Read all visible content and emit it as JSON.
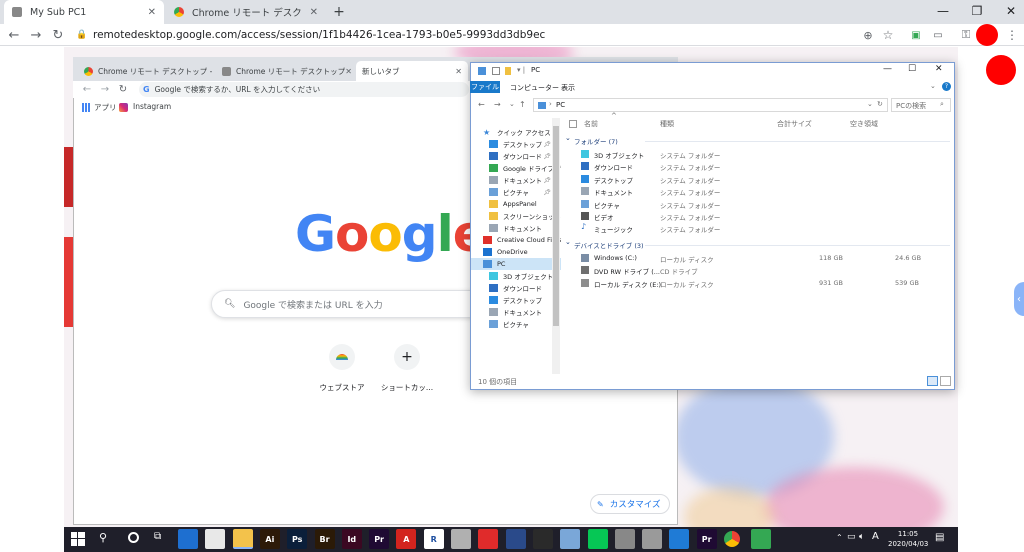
{
  "browser": {
    "tabs": [
      {
        "title": "My Sub PC1",
        "active": true
      },
      {
        "title": "Chrome リモート デスクトップ - Chrom",
        "active": false
      }
    ],
    "new_tab_symbol": "+",
    "url": "remotedesktop.google.com/access/session/1f1b4426-1cea-1793-b0e5-9993dd3db9ec"
  },
  "remote": {
    "inner_chrome": {
      "tabs": [
        {
          "title": "Chrome リモート デスクトップ - Chrom"
        },
        {
          "title": "Chrome リモート デスクトップ"
        },
        {
          "title": "新しいタブ"
        }
      ],
      "address_placeholder": "Google で検索するか、URL を入力してください",
      "bookmarks": [
        "アプリ",
        "Instagram"
      ],
      "google_logo": [
        "G",
        "o",
        "o",
        "g",
        "l",
        "e"
      ],
      "logo_colors": [
        "#4285F4",
        "#EA4335",
        "#FBBC05",
        "#4285F4",
        "#34A853",
        "#EA4335"
      ],
      "search_placeholder": "Google で検索または URL を入力",
      "shortcuts": [
        {
          "label": "ウェブストア",
          "icon": "rainbow-icon"
        },
        {
          "label": "ショートカッ...",
          "icon": "plus-icon",
          "symbol": "+"
        }
      ],
      "customize_label": "カスタマイズ"
    },
    "explorer": {
      "title": "PC",
      "ribbon_tabs": [
        "ファイル",
        "コンピューター",
        "表示"
      ],
      "breadcrumb": "PC",
      "search_placeholder": "PCの検索",
      "nav_items": [
        {
          "label": "クイック アクセス",
          "icon": "star-icon",
          "level": 0
        },
        {
          "label": "デスクトップ",
          "icon": "desktop-icon",
          "level": 1,
          "pinned": true
        },
        {
          "label": "ダウンロード",
          "icon": "download-icon",
          "level": 1,
          "pinned": true
        },
        {
          "label": "Google ドライブ",
          "icon": "drive-icon",
          "level": 1,
          "pinned": true
        },
        {
          "label": "ドキュメント",
          "icon": "document-icon",
          "level": 1,
          "pinned": true
        },
        {
          "label": "ピクチャ",
          "icon": "picture-icon",
          "level": 1,
          "pinned": true
        },
        {
          "label": "AppsPanel",
          "icon": "folder-icon",
          "level": 1
        },
        {
          "label": "スクリーンショット",
          "icon": "folder-icon",
          "level": 1
        },
        {
          "label": "ドキュメント",
          "icon": "document-icon",
          "level": 1
        },
        {
          "label": "Creative Cloud Files",
          "icon": "creative-cloud-icon",
          "level": 0
        },
        {
          "label": "OneDrive",
          "icon": "onedrive-icon",
          "level": 0
        },
        {
          "label": "PC",
          "icon": "pc-icon",
          "level": 0,
          "selected": true
        },
        {
          "label": "3D オブジェクト",
          "icon": "3d-icon",
          "level": 1
        },
        {
          "label": "ダウンロード",
          "icon": "download-icon",
          "level": 1
        },
        {
          "label": "デスクトップ",
          "icon": "desktop-icon",
          "level": 1
        },
        {
          "label": "ドキュメント",
          "icon": "document-icon",
          "level": 1
        },
        {
          "label": "ピクチャ",
          "icon": "picture-icon",
          "level": 1
        }
      ],
      "columns": [
        "名前",
        "種類",
        "合計サイズ",
        "空き領域"
      ],
      "groups": [
        {
          "header": "フォルダー (7)",
          "rows": [
            {
              "name": "3D オブジェクト",
              "type": "システム フォルダー",
              "total": "",
              "free": "",
              "icon": "3d-icon"
            },
            {
              "name": "ダウンロード",
              "type": "システム フォルダー",
              "total": "",
              "free": "",
              "icon": "download-icon"
            },
            {
              "name": "デスクトップ",
              "type": "システム フォルダー",
              "total": "",
              "free": "",
              "icon": "desktop-icon"
            },
            {
              "name": "ドキュメント",
              "type": "システム フォルダー",
              "total": "",
              "free": "",
              "icon": "document-icon"
            },
            {
              "name": "ピクチャ",
              "type": "システム フォルダー",
              "total": "",
              "free": "",
              "icon": "picture-icon"
            },
            {
              "name": "ビデオ",
              "type": "システム フォルダー",
              "total": "",
              "free": "",
              "icon": "video-icon"
            },
            {
              "name": "ミュージック",
              "type": "システム フォルダー",
              "total": "",
              "free": "",
              "icon": "music-icon"
            }
          ]
        },
        {
          "header": "デバイスとドライブ (3)",
          "rows": [
            {
              "name": "Windows (C:)",
              "type": "ローカル ディスク",
              "total": "118 GB",
              "free": "24.6 GB",
              "icon": "drive-c-icon"
            },
            {
              "name": "DVD RW ドライブ (...",
              "type": "CD ドライブ",
              "total": "",
              "free": "",
              "icon": "dvd-icon"
            },
            {
              "name": "ローカル ディスク (E:)",
              "type": "ローカル ディスク",
              "total": "931 GB",
              "free": "539 GB",
              "icon": "disk-icon"
            }
          ]
        }
      ],
      "status": "10 個の項目"
    },
    "taskbar": {
      "apps": [
        {
          "label": "",
          "icon": "edge-icon",
          "color": "#1e6fd0"
        },
        {
          "label": "",
          "icon": "pdf-icon",
          "color": "#e8e8e8"
        },
        {
          "label": "",
          "icon": "file-explorer-icon",
          "color": "#f3c24b"
        },
        {
          "label": "Ai",
          "icon": "illustrator-icon",
          "color": "#2d1a08"
        },
        {
          "label": "Ps",
          "icon": "photoshop-icon",
          "color": "#0b1f3a"
        },
        {
          "label": "Br",
          "icon": "bridge-icon",
          "color": "#2b1a07"
        },
        {
          "label": "Id",
          "icon": "indesign-icon",
          "color": "#3b0822"
        },
        {
          "label": "Pr",
          "icon": "premiere-icon",
          "color": "#1f0a33"
        },
        {
          "label": "A",
          "icon": "acrobat-icon",
          "color": "#d3241e"
        },
        {
          "label": "R",
          "icon": "r-icon",
          "color": "#ffffff"
        },
        {
          "label": "",
          "icon": "pdf-tool-icon",
          "color": "#b0b0b0"
        },
        {
          "label": "",
          "icon": "camera-app-icon",
          "color": "#e02b2b"
        },
        {
          "label": "",
          "icon": "circle-app-icon",
          "color": "#2a4a8a"
        },
        {
          "label": "",
          "icon": "unreal-icon",
          "color": "#2a2a2a"
        },
        {
          "label": "",
          "icon": "cloud-app-icon",
          "color": "#7aa7d8"
        },
        {
          "label": "",
          "icon": "line-icon",
          "color": "#06c755"
        },
        {
          "label": "",
          "icon": "globe-icon",
          "color": "#888888"
        },
        {
          "label": "",
          "icon": "dvd-app-icon",
          "color": "#9a9a9a"
        },
        {
          "label": "",
          "icon": "remote-app-icon",
          "color": "#1f7bd6"
        },
        {
          "label": "Pr",
          "icon": "premiere-icon-2",
          "color": "#1f0a33"
        },
        {
          "label": "",
          "icon": "chrome-icon",
          "color": "#f4c20d"
        },
        {
          "label": "",
          "icon": "drive-tb-icon",
          "color": "#34a853"
        }
      ],
      "clock_time": "11:05",
      "clock_date": "2020/04/03"
    }
  }
}
